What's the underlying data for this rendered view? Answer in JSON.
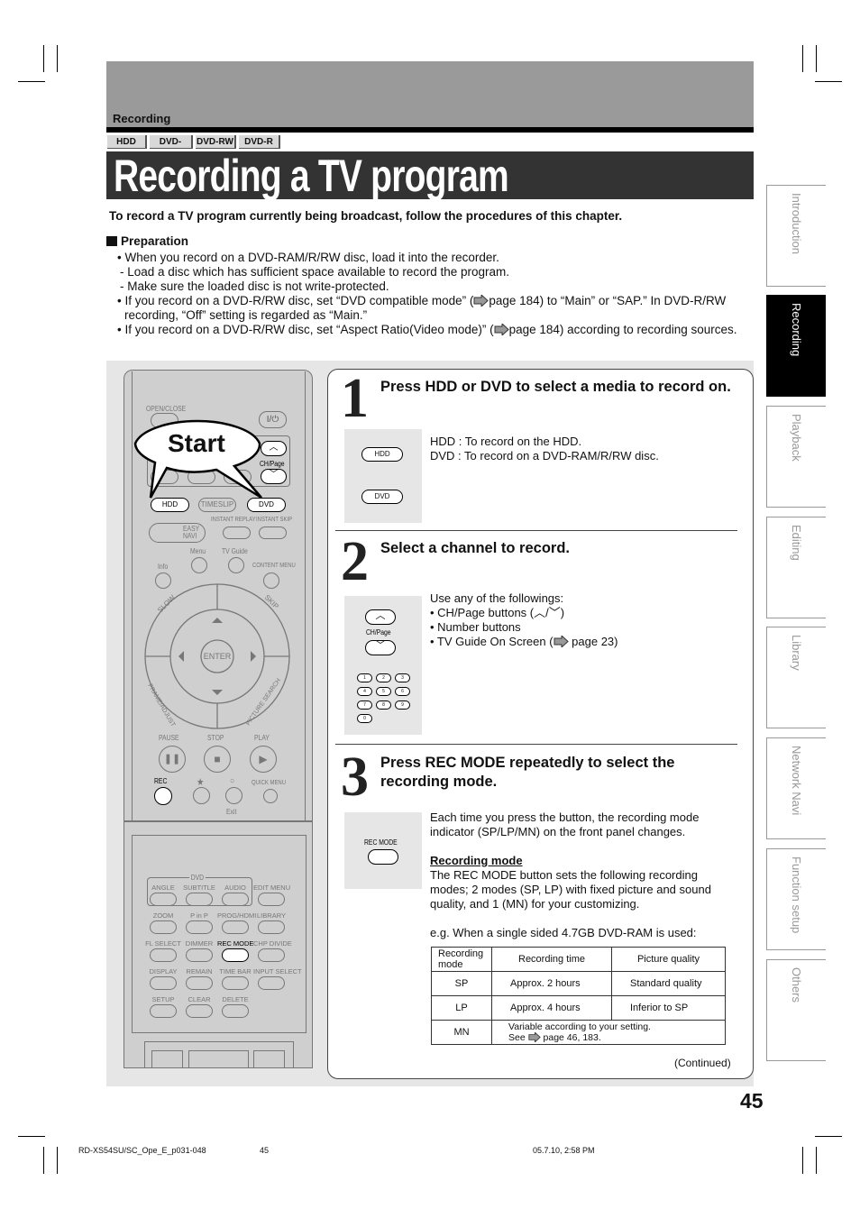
{
  "header": {
    "section": "Recording",
    "media": [
      "HDD",
      "DVD-RAM",
      "DVD-RW",
      "DVD-R"
    ],
    "title": "Recording a TV program",
    "intro": "To record a TV program currently being broadcast, follow the procedures of this chapter."
  },
  "preparation": {
    "heading": "Preparation",
    "lines": [
      "•  When you record on a DVD-RAM/R/RW disc, load it into the recorder.",
      "- Load a disc which has sufficient space available to record the program.",
      "- Make sure the loaded disc is not write-protected.",
      "•  If you record on a DVD-R/RW disc, set “DVD compatible mode” (",
      "page 184) to “Main” or “SAP.” In DVD-R/RW",
      "recording, “Off” setting is regarded as “Main.”",
      "•  If you record on a DVD-R/RW disc, set “Aspect Ratio(Video mode)” (",
      "page 184) according to recording sources."
    ]
  },
  "remote": {
    "callout": "Start",
    "labels": {
      "open_close": "OPEN/CLOSE",
      "power": "I/⏻",
      "ch_page": "CH/Page",
      "hdd": "HDD",
      "timeslip": "TIMESLIP",
      "dvd": "DVD",
      "instant_replay": "INSTANT REPLAY",
      "instant_skip": "INSTANT SKIP",
      "easy_navi": "EASY NAVI",
      "menu": "Menu",
      "tv_guide": "TV Guide",
      "info": "Info",
      "content_menu": "CONTENT MENU",
      "slow": "SLOW",
      "skip": "SKIP",
      "enter": "ENTER",
      "frame_adjust": "FRAME/ADJUST",
      "picture_search": "PICTURE SEARCH",
      "pause": "PAUSE",
      "stop": "STOP",
      "play": "PLAY",
      "rec": "REC",
      "star": "★",
      "circle": "○",
      "quick_menu": "QUICK MENU",
      "exit": "Exit",
      "dvd_group": "DVD"
    },
    "grid": [
      [
        "ANGLE",
        "SUBTITLE",
        "AUDIO",
        "EDIT MENU"
      ],
      [
        "ZOOM",
        "P in P",
        "PROG/HDMI",
        "LIBRARY"
      ],
      [
        "FL SELECT",
        "DIMMER",
        "REC MODE",
        "CHP DIVIDE"
      ],
      [
        "DISPLAY",
        "REMAIN",
        "TIME BAR",
        "INPUT SELECT"
      ],
      [
        "SETUP",
        "CLEAR",
        "DELETE"
      ]
    ]
  },
  "steps": [
    {
      "number": "1",
      "heading": "Press HDD or DVD to select a media to record on.",
      "buttons": [
        "HDD",
        "DVD"
      ],
      "lines": [
        "HDD : To record on the HDD.",
        "DVD : To record on a DVD-RAM/R/RW disc."
      ]
    },
    {
      "number": "2",
      "heading": "Select a channel to record.",
      "button_label": "CH/Page",
      "number_keys": [
        "1",
        "2",
        "3",
        "4",
        "5",
        "6",
        "7",
        "8",
        "9",
        "0"
      ],
      "lines": [
        "Use any of the followings:",
        "• CH/Page buttons (",
        "• Number buttons",
        "• TV Guide On Screen (",
        "page 23)"
      ]
    },
    {
      "number": "3",
      "heading": "Press REC MODE repeatedly to select the recording mode.",
      "button_label": "REC MODE",
      "lines": [
        "Each time you press the button, the recording mode",
        "indicator (SP/LP/MN) on the front panel changes."
      ],
      "subheading": "Recording mode",
      "body": [
        "The REC MODE button sets the following recording",
        "modes; 2 modes (SP, LP) with fixed picture and sound",
        "quality, and 1 (MN) for your customizing."
      ],
      "example": "e.g. When a single sided 4.7GB DVD-RAM is used:",
      "table": {
        "headers": [
          "Recording mode",
          "Recording time",
          "Picture quality"
        ],
        "rows": [
          [
            "SP",
            "Approx. 2 hours",
            "Standard quality"
          ],
          [
            "LP",
            "Approx. 4 hours",
            "Inferior to SP"
          ]
        ],
        "mn_row": {
          "mode": "MN",
          "line1": "Variable according to your setting.",
          "line2a": "See",
          "line2b": "page 46, 183."
        }
      }
    }
  ],
  "continued": "(Continued)",
  "side_tabs": [
    "Introduction",
    "Recording",
    "Playback",
    "Editing",
    "Library",
    "Network Navi",
    "Function setup",
    "Others"
  ],
  "active_tab": "Recording",
  "page_number": "45",
  "footer": {
    "file": "RD-XS54SU/SC_Ope_E_p031-048",
    "page": "45",
    "date": "05.7.10, 2:58 PM"
  }
}
